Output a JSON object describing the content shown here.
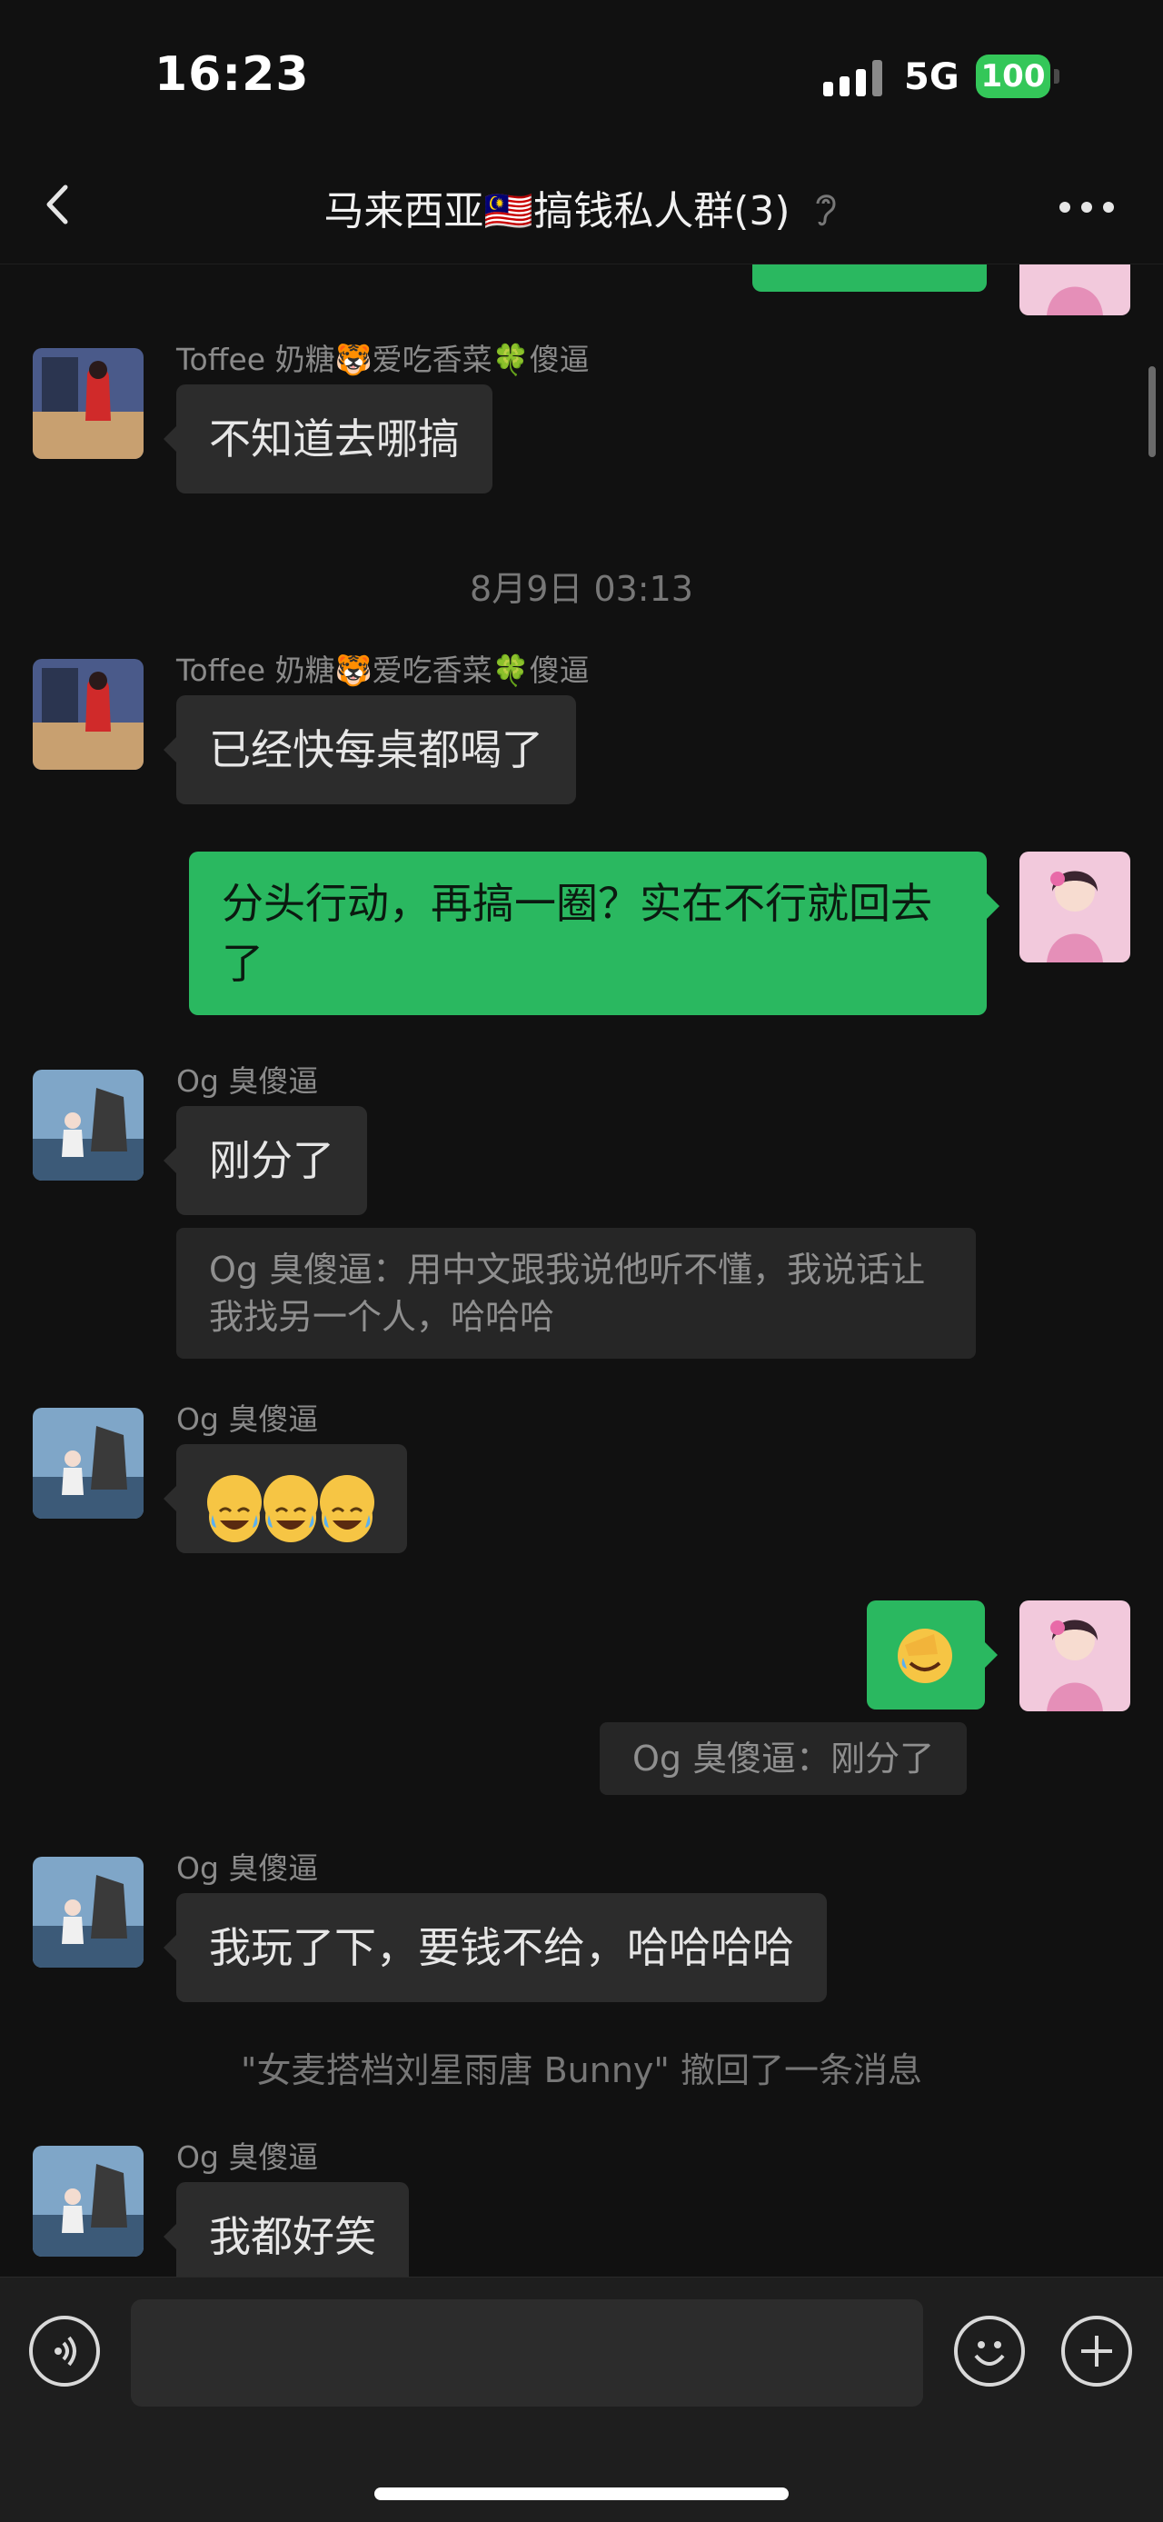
{
  "status_bar": {
    "time": "16:23",
    "network": "5G",
    "battery": "100"
  },
  "header": {
    "title": "马来西亚🇲🇾搞钱私人群(3)"
  },
  "messages": {
    "m1_sender": "Toffee 奶糖🐯爱吃香菜🍀傻逼",
    "m1_text": "不知道去哪搞",
    "timestamp": "8月9日 03:13",
    "m2_sender": "Toffee 奶糖🐯爱吃香菜🍀傻逼",
    "m2_text": "已经快每桌都喝了",
    "m3_text": "分头行动，再搞一圈？实在不行就回去了",
    "m4_sender": "Og 臭傻逼",
    "m4_text": "刚分了",
    "q1_text": "Og 臭傻逼：用中文跟我说他听不懂，我说话让我找另一个人，哈哈哈",
    "m5_sender": "Og 臭傻逼",
    "m6_quote": "Og 臭傻逼：刚分了",
    "m7_sender": "Og 臭傻逼",
    "m7_text": "我玩了下，要钱不给，哈哈哈哈",
    "recall_note": "\"女麦搭档刘星雨唐 Bunny\" 撤回了一条消息",
    "m8_sender": "Og 臭傻逼",
    "m8_text": "我都好笑"
  },
  "input_bar": {
    "placeholder": ""
  },
  "colors": {
    "background": "#111111",
    "bubble_out": "#2ab860",
    "bubble_in": "#2c2c2c",
    "battery": "#34c759"
  },
  "icons": [
    "back-icon",
    "ear-icon",
    "more-icon",
    "voice-icon",
    "emoji-icon",
    "plus-icon"
  ]
}
